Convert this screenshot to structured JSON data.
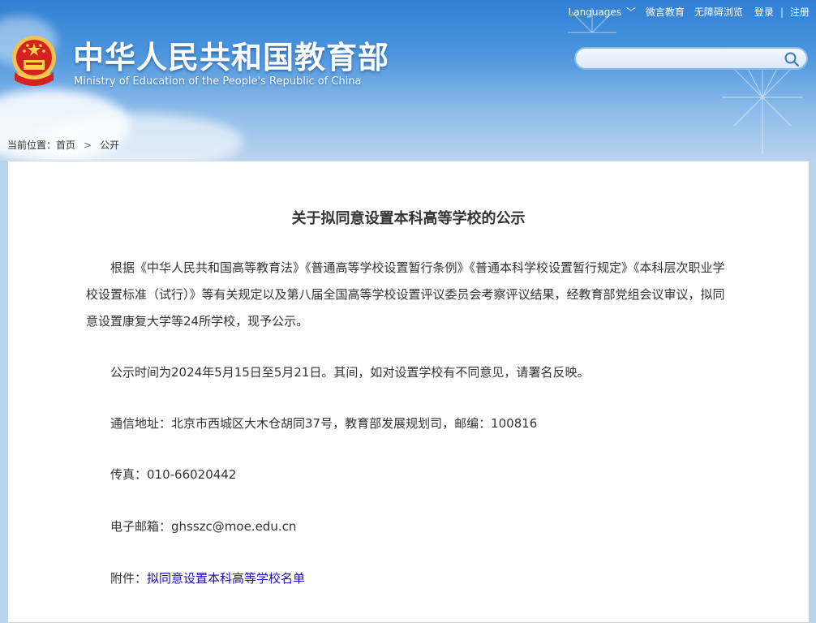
{
  "topbar": {
    "languages": "Languages",
    "weibo": "微言教育",
    "accessibility": "无障碍浏览",
    "login": "登录",
    "separator": "|",
    "register": "注册"
  },
  "header": {
    "title_cn": "中华人民共和国教育部",
    "title_en": "Ministry of Education of the People's Republic of China"
  },
  "search": {
    "placeholder": "",
    "value": ""
  },
  "breadcrumb": {
    "prefix": "当前位置：",
    "home": "首页",
    "current": "公开"
  },
  "article": {
    "title": "关于拟同意设置本科高等学校的公示",
    "paragraphs": [
      "根据《中华人民共和国高等教育法》《普通高等学校设置暂行条例》《普通本科学校设置暂行规定》《本科层次职业学校设置标准（试行）》等有关规定以及第八届全国高等学校设置评议委员会考察评议结果，经教育部党组会议审议，拟同意设置康复大学等24所学校，现予公示。",
      "公示时间为2024年5月15日至5月21日。其间，如对设置学校有不同意见，请署名反映。",
      "通信地址：北京市西城区大木仓胡同37号，教育部发展规划司，邮编：100816",
      "传真：010-66020442",
      "电子邮箱：ghsszc@moe.edu.cn"
    ],
    "attachment_label": "附件：",
    "attachment_link": "拟同意设置本科高等学校名单"
  }
}
